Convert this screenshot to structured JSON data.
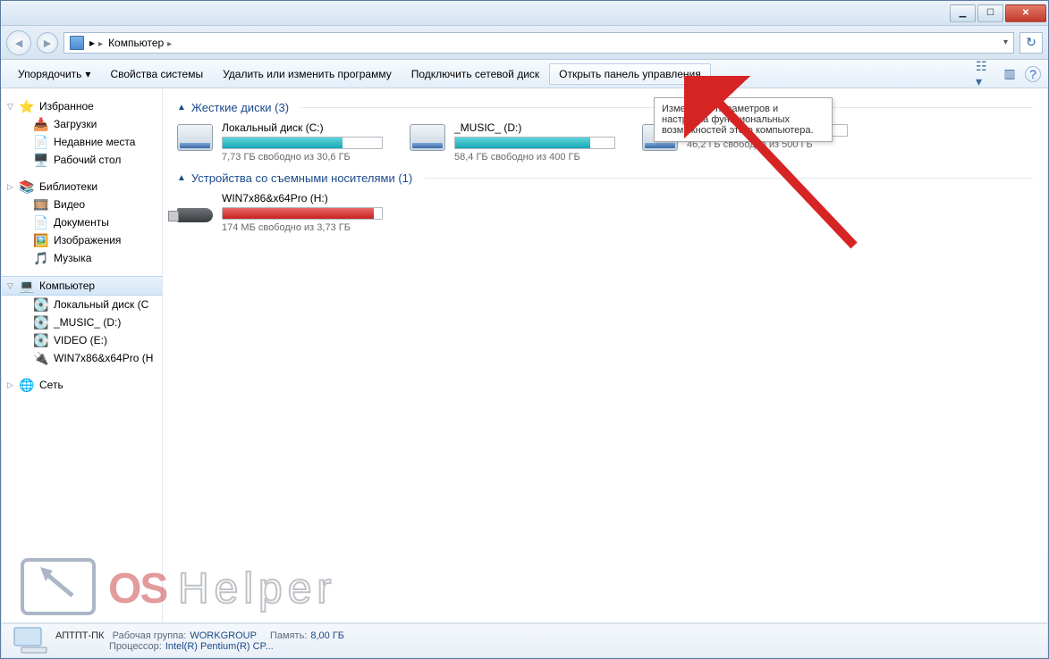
{
  "addressbar": {
    "location": "Компьютер"
  },
  "toolbar": {
    "organize": "Упорядочить",
    "system_props": "Свойства системы",
    "uninstall": "Удалить или изменить программу",
    "map_drive": "Подключить сетевой диск",
    "control_panel": "Открыть панель управления"
  },
  "tooltip": {
    "text": "Изменение параметров и настройка функциональных возможностей этого компьютера."
  },
  "nav": {
    "favorites": "Избранное",
    "downloads": "Загрузки",
    "recent": "Недавние места",
    "desktop": "Рабочий стол",
    "libraries": "Библиотеки",
    "video": "Видео",
    "documents": "Документы",
    "pictures": "Изображения",
    "music": "Музыка",
    "computer": "Компьютер",
    "drive_c": "Локальный диск (C",
    "drive_d": "_MUSIC_ (D:)",
    "drive_e": "VIDEO (E:)",
    "drive_h": "WIN7x86&x64Pro (H",
    "network": "Сеть"
  },
  "groups": {
    "hdd": "Жесткие диски (3)",
    "removable": "Устройства со съемными носителями (1)"
  },
  "drives": [
    {
      "name": "Локальный диск (C:)",
      "sub": "7,73 ГБ свободно из 30,6 ГБ",
      "color": "teal",
      "pct": 75
    },
    {
      "name": "_MUSIC_ (D:)",
      "sub": "58,4 ГБ свободно из 400 ГБ",
      "color": "teal",
      "pct": 85
    },
    {
      "name": "",
      "sub": "46,2 ГБ свободно из 500 ГБ",
      "color": "red",
      "pct": 91
    }
  ],
  "removable": [
    {
      "name": "WIN7x86&x64Pro (H:)",
      "sub": "174 МБ свободно из 3,73 ГБ",
      "color": "red",
      "pct": 95
    }
  ],
  "details": {
    "name": "АПТПТ-ПК",
    "workgroup_label": "Рабочая группа:",
    "workgroup": "WORKGROUP",
    "memory_label": "Память:",
    "memory": "8,00 ГБ",
    "cpu_label": "Процессор:",
    "cpu": "Intel(R) Pentium(R) CP..."
  },
  "watermark": "OS Helper"
}
